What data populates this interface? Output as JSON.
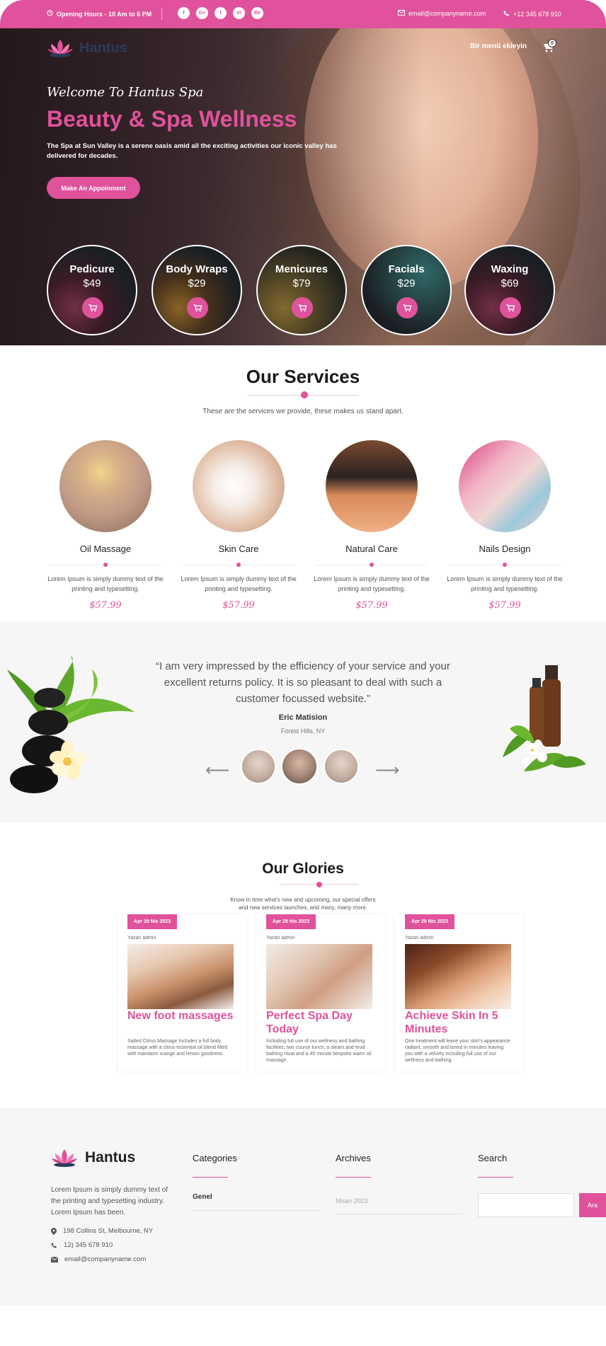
{
  "topbar": {
    "hours": "Opening Hours - 10 Am to 6 PM",
    "socials": [
      "f",
      "G+",
      "t",
      "in",
      "Be"
    ],
    "email": "email@companyname.com",
    "phone": "+12 345 678 910"
  },
  "header": {
    "brand": "Hantus",
    "menu_label": "Bir menü ekleyin",
    "cart_count": "0"
  },
  "hero": {
    "welcome": "Welcome To Hantus Spa",
    "headline": "Beauty & Spa Wellness",
    "lead": "The Spa at Sun Valley is a serene oasis amid all the exciting activities our iconic valley has delivered for decades.",
    "cta": "Make An Appoinment",
    "packages": [
      {
        "name": "Pedicure",
        "price": "$49"
      },
      {
        "name": "Body Wraps",
        "price": "$29"
      },
      {
        "name": "Menicures",
        "price": "$79"
      },
      {
        "name": "Facials",
        "price": "$29"
      },
      {
        "name": "Waxing",
        "price": "$69"
      }
    ]
  },
  "services": {
    "title": "Our Services",
    "subtitle": "These are the services we provide, these makes us stand apart.",
    "items": [
      {
        "title": "Oil Massage",
        "desc": "Lorem Ipsum is simply dummy text of the printing and typesetting.",
        "price": "$57.99"
      },
      {
        "title": "Skin Care",
        "desc": "Lorem Ipsum is simply dummy text of the printing and typesetting.",
        "price": "$57.99"
      },
      {
        "title": "Natural Care",
        "desc": "Lorem Ipsum is simply dummy text of the printing and typesetting.",
        "price": "$57.99"
      },
      {
        "title": "Nails Design",
        "desc": "Lorem Ipsum is simply dummy text of the printing and typesetting.",
        "price": "$57.99"
      }
    ]
  },
  "testimonial": {
    "quote": "“I am very impressed by the efficiency of your service and your excellent returns policy. It is so pleasant to deal with such a customer focussed website.”",
    "author": "Eric Matision",
    "location": "Forest Hills, NY",
    "prev": "⟵",
    "next": "⟶"
  },
  "glories": {
    "title": "Our Glories",
    "subtitle": "Know in time what's new and upcoming, our special offers and new services launches, and many, many more.",
    "posts": [
      {
        "date": "Apr 29 Nis 2023",
        "author": "Yazan admin",
        "title": "New foot massages",
        "desc": "Salted Citrus Massage Includes a full body massage with a citrus essential oil blend filled with mandarin orange and lemon goodness."
      },
      {
        "date": "Apr 29 Nis 2023",
        "author": "Yazan admin",
        "title": "Perfect Spa Day Today",
        "desc": "Including full use of our wellness and bathing facilities; two course lunch; a steam and mud bathing ritual and a 45 minute bespoke warm oil massage."
      },
      {
        "date": "Apr 29 Nis 2023",
        "author": "Yazan admin",
        "title": "Achieve Skin In 5 Minutes",
        "desc": "One treatment will leave your skin's appearance radiant, smooth and toned in minutes leaving you with a velvety including full use of our wellness and bathing."
      }
    ]
  },
  "footer": {
    "brand": "Hantus",
    "about": "Lorem Ipsum is simply dummy text of the printing and typesetting industry. Lorem Ipsum has been.",
    "address": "198 Collins St, Melbourne, NY",
    "phone": "12) 345 678 910",
    "email": "email@companyname.com",
    "categories_title": "Categories",
    "category": "Genel",
    "archives_title": "Archives",
    "archive": "Nisan 2023",
    "search_title": "Search",
    "search_button": "Ara"
  },
  "colors": {
    "accent": "#e0529c"
  }
}
